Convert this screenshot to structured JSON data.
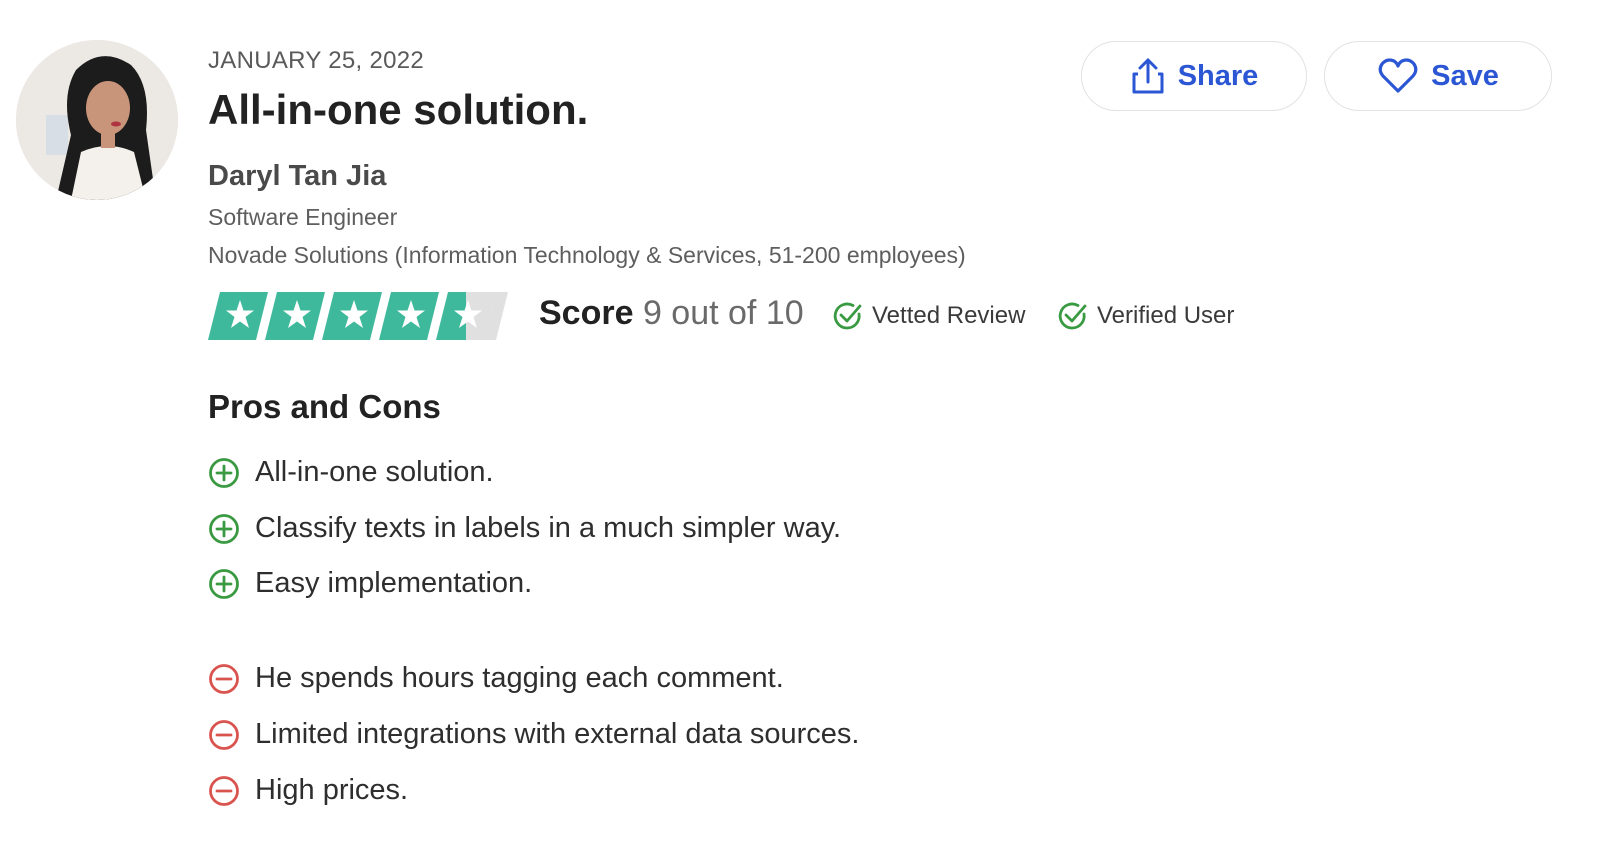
{
  "review": {
    "date": "JANUARY 25, 2022",
    "title": "All-in-one solution."
  },
  "reviewer": {
    "name": "Daryl Tan Jia",
    "role": "Software Engineer",
    "company": "Novade Solutions (Information Technology & Services, 51-200 employees)"
  },
  "actions": {
    "share_label": "Share",
    "save_label": "Save"
  },
  "rating": {
    "stars": 4.5,
    "stars_max": 5,
    "score_label": "Score",
    "score_value": "9 out of 10"
  },
  "badges": {
    "vetted": "Vetted Review",
    "verified": "Verified User"
  },
  "pros_cons": {
    "heading": "Pros and Cons",
    "pros": [
      "All-in-one solution.",
      "Classify texts in labels in a much simpler way.",
      "Easy implementation."
    ],
    "cons": [
      "He spends hours tagging each comment.",
      "Limited integrations with external data sources.",
      "High prices."
    ]
  },
  "icons": {
    "share": "share-icon",
    "save": "heart-icon",
    "badge": "check-circle-icon",
    "pro": "plus-circle-icon",
    "con": "minus-circle-icon",
    "star": "star-icon"
  },
  "colors": {
    "star_fill": "#3eb99c",
    "star_empty": "#e0e0e0",
    "accent_blue": "#2b56d4",
    "pro_green": "#3a9a42",
    "con_red": "#d9534f",
    "badge_green": "#3a9a42"
  }
}
